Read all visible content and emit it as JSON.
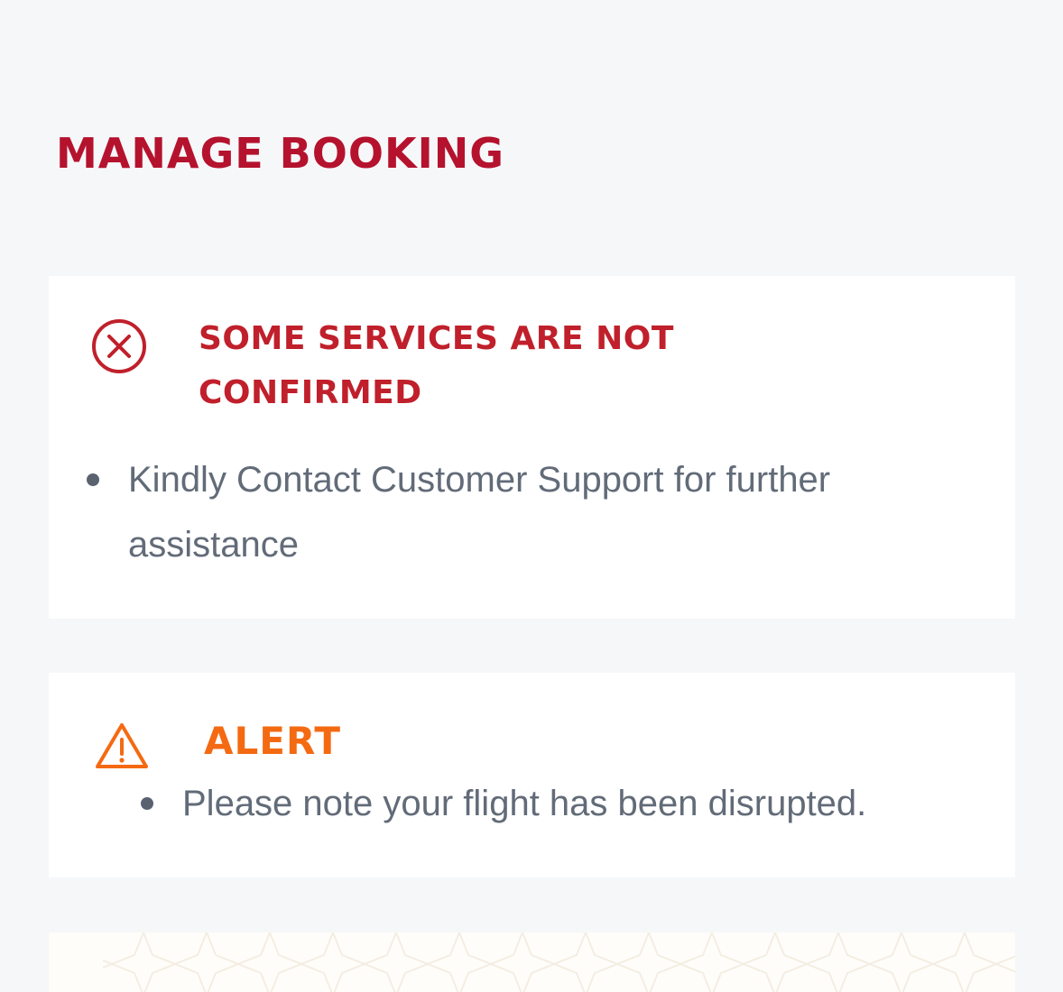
{
  "page": {
    "title": "MANAGE BOOKING"
  },
  "error_notice": {
    "icon": "close-circle-icon",
    "title": "SOME SERVICES ARE NOT CONFIRMED",
    "items": [
      "Kindly Contact Customer Support for further assistance"
    ]
  },
  "alert_notice": {
    "icon": "warning-triangle-icon",
    "title": "ALERT",
    "items": [
      "Please note your flight has been disrupted."
    ]
  },
  "colors": {
    "background": "#f6f7f9",
    "brand_red": "#b5122e",
    "error_red": "#c0202b",
    "alert_orange": "#f46a12",
    "body_text": "#626b78"
  }
}
